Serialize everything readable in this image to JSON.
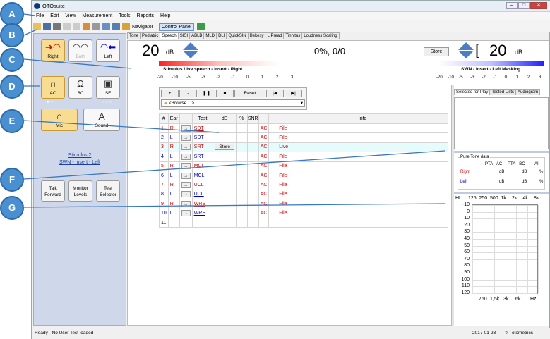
{
  "callouts": [
    "A",
    "B",
    "C",
    "D",
    "E",
    "F",
    "G"
  ],
  "app_title": "OTOsuite",
  "menu": [
    "File",
    "Edit",
    "View",
    "Measurement",
    "Tools",
    "Reports",
    "Help"
  ],
  "toolbar": {
    "navigator": "Navigator",
    "control_panel": "Control Panel"
  },
  "left": {
    "right": "Right",
    "both": "Both",
    "left": "Left",
    "ac": "AC",
    "bc": "BC",
    "sf": "SF",
    "mic": "Mic",
    "sound": "Sound",
    "sound_letter": "A",
    "stimulus_line1": "Stimulus 2",
    "stimulus_line2": "SWN - Insert - Left",
    "talk": "Talk Forward",
    "monitor": "Monitor Levels",
    "test_selector": "Test Selector"
  },
  "tabs": [
    "Tone",
    "Pediatric",
    "Speech",
    "SISI",
    "ABLB",
    "MLD",
    "DLI",
    "QuickSIN",
    "Bekesy",
    "LIPread",
    "Tinnitus",
    "Loudness Scaling"
  ],
  "active_tab": "Speech",
  "stim": {
    "value": "20",
    "unit": "dB",
    "caption": "Stimulus  Live speech - Insert - Right",
    "score": "0%, 0/0",
    "store": "Store"
  },
  "mask": {
    "value": "20",
    "unit": "dB",
    "caption": "SWN - Insert - Left  Masking",
    "bracket": "["
  },
  "scale": [
    "-20",
    "-10",
    "-5",
    "-3",
    "-2",
    "-1",
    "0",
    "1",
    "2",
    "3"
  ],
  "controls": {
    "plus": "+",
    "minus": "-",
    "pause": "❚❚",
    "stop": "■",
    "reset": "Reset",
    "prev": "|◀",
    "next": "▶|",
    "browse": "<Browse ...>"
  },
  "columns": [
    "#",
    "Ear",
    "",
    "Test",
    "dB",
    "%",
    "SNR",
    "",
    "",
    "Info"
  ],
  "rows": [
    {
      "n": "1",
      "ear": "R",
      "test": "SDT",
      "tr": "AC",
      "info": "File",
      "c": "red"
    },
    {
      "n": "2",
      "ear": "L",
      "test": "SDT",
      "tr": "AC",
      "info": "File",
      "c": "blue"
    },
    {
      "n": "3",
      "ear": "R",
      "test": "SRT",
      "tr": "AC",
      "info": "Live",
      "c": "red",
      "store": "Store"
    },
    {
      "n": "4",
      "ear": "L",
      "test": "SRT",
      "tr": "AC",
      "info": "File",
      "c": "blue"
    },
    {
      "n": "5",
      "ear": "R",
      "test": "MCL",
      "tr": "AC",
      "info": "File",
      "c": "red"
    },
    {
      "n": "6",
      "ear": "L",
      "test": "MCL",
      "tr": "AC",
      "info": "File",
      "c": "blue"
    },
    {
      "n": "7",
      "ear": "R",
      "test": "UCL",
      "tr": "AC",
      "info": "File",
      "c": "red"
    },
    {
      "n": "8",
      "ear": "L",
      "test": "UCL",
      "tr": "AC",
      "info": "File",
      "c": "blue"
    },
    {
      "n": "9",
      "ear": "R",
      "test": "WRS",
      "tr": "AC",
      "info": "File",
      "c": "red"
    },
    {
      "n": "10",
      "ear": "L",
      "test": "WRS",
      "tr": "AC",
      "info": "File",
      "c": "blue"
    },
    {
      "n": "11",
      "ear": "",
      "test": "",
      "tr": "",
      "info": "",
      "c": ""
    }
  ],
  "right_tabs": [
    "Selected for Play",
    "Tested Lists",
    "Audiogram"
  ],
  "pta": {
    "title": "Pure Tone data",
    "ac": "PTA - AC",
    "bc": "PTA - BC",
    "ai": "AI",
    "right": "Right",
    "left": "Left",
    "db": "dB",
    "pct": "%"
  },
  "audiogram": {
    "hl": "HL",
    "freqs": [
      "125",
      "250",
      "500",
      "1k",
      "2k",
      "4k",
      "8k"
    ],
    "levels": [
      "-10",
      "0",
      "10",
      "20",
      "30",
      "40",
      "50",
      "60",
      "70",
      "80",
      "90",
      "100",
      "110",
      "120"
    ],
    "bottom": [
      "750",
      "1,5k",
      "3k",
      "6k",
      "Hz"
    ]
  },
  "status": {
    "left": "Ready - No User Test loaded",
    "date": "2017-01-23",
    "brand": "otometrics"
  }
}
